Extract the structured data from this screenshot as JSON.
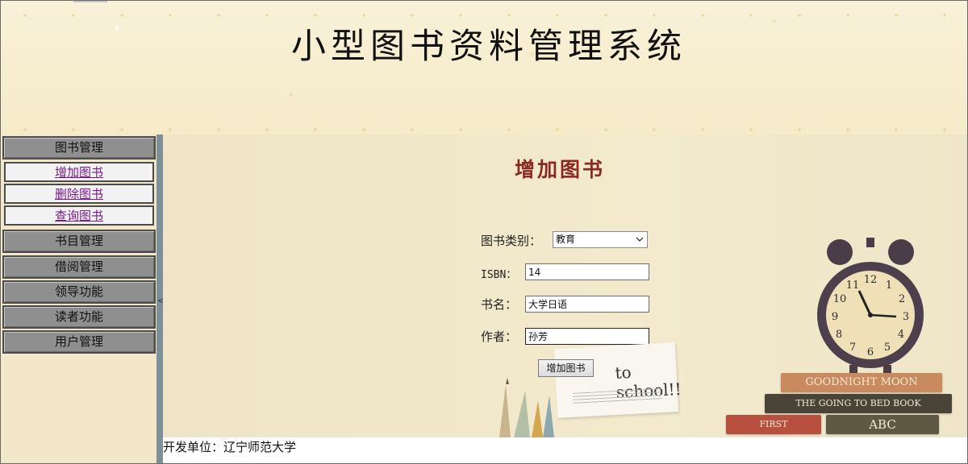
{
  "header": {
    "app_title": "小型图书资料管理系统"
  },
  "sidebar": {
    "sections": [
      {
        "label": "图书管理"
      },
      {
        "label": "书目管理"
      },
      {
        "label": "借阅管理"
      },
      {
        "label": "领导功能"
      },
      {
        "label": "读者功能"
      },
      {
        "label": "用户管理"
      }
    ],
    "book_submenu": [
      {
        "label": "增加图书"
      },
      {
        "label": "删除图书"
      },
      {
        "label": "查询图书"
      }
    ],
    "collapse_glyph": "<"
  },
  "main": {
    "heading": "增加图书",
    "form": {
      "category_label": "图书类别：",
      "category_value": "教育",
      "isbn_label": "ISBN：",
      "isbn_value": "14",
      "title_label": "书名：",
      "title_value": "大学日语",
      "author_label": "作者：",
      "author_value": "孙芳",
      "submit_label": "增加图书"
    },
    "illustration": {
      "note_text": "to school!!",
      "book_titles": [
        "GOODNIGHT MOON",
        "THE GOING TO BED BOOK",
        "ABC"
      ],
      "book_spine_labels": [
        "FIRST"
      ],
      "clock_numbers": [
        "12",
        "1",
        "2",
        "3",
        "4",
        "5",
        "6",
        "7",
        "8",
        "9",
        "10",
        "11"
      ]
    }
  },
  "footer": {
    "developer_text": "开发单位：辽宁师范大学"
  },
  "colors": {
    "heading": "#8b2a22",
    "link": "#7a1a8e",
    "menu_header_bg": "#8f8f8f",
    "sidebar_bg": "#f3e7c9",
    "sidebar_strip": "#7e8f97"
  }
}
